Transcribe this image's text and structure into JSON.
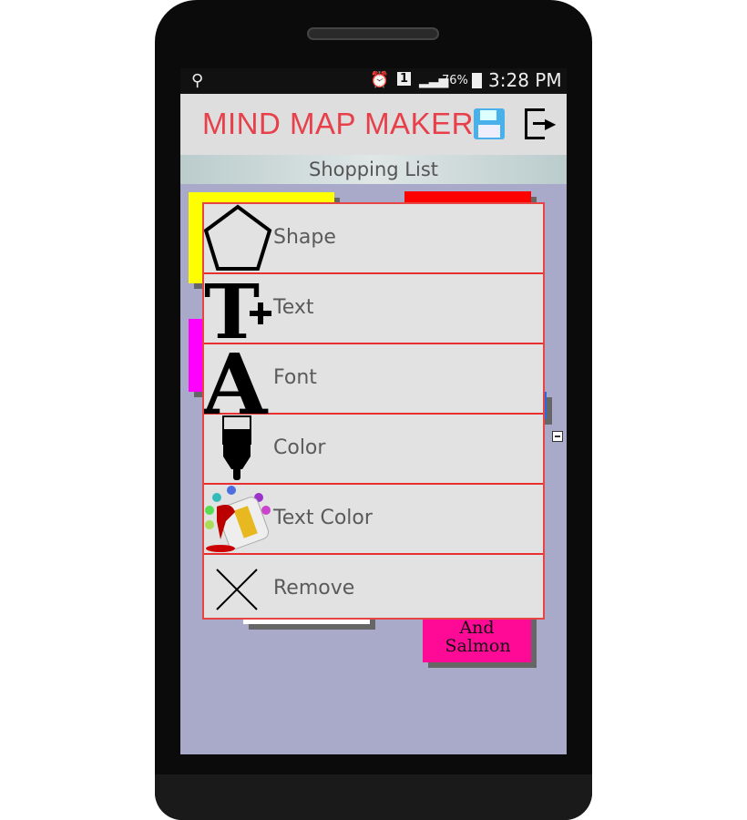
{
  "status_bar": {
    "battery": "76%",
    "time": "3:28 PM",
    "sim": "1",
    "icons": [
      "usb-icon",
      "alarm-icon",
      "sim-icon",
      "signal-icon",
      "battery-charging-icon"
    ]
  },
  "header": {
    "title": "MIND MAP MAKER",
    "icons": [
      "save-floppy-icon",
      "exit-icon"
    ]
  },
  "map": {
    "title": "Shopping List",
    "visible_node_text": "And Salmon"
  },
  "menu": {
    "items": [
      {
        "label": "Shape",
        "icon": "pentagon-icon"
      },
      {
        "label": "Text",
        "icon": "text-add-icon"
      },
      {
        "label": "Font",
        "icon": "font-icon"
      },
      {
        "label": "Color",
        "icon": "paintbrush-icon"
      },
      {
        "label": "Text Color",
        "icon": "paint-bucket-icon"
      },
      {
        "label": "Remove",
        "icon": "close-x-icon"
      }
    ]
  },
  "colors": {
    "title": "#e8404a",
    "menu_border": "#e84444",
    "canvas": "#a9a9c9"
  }
}
